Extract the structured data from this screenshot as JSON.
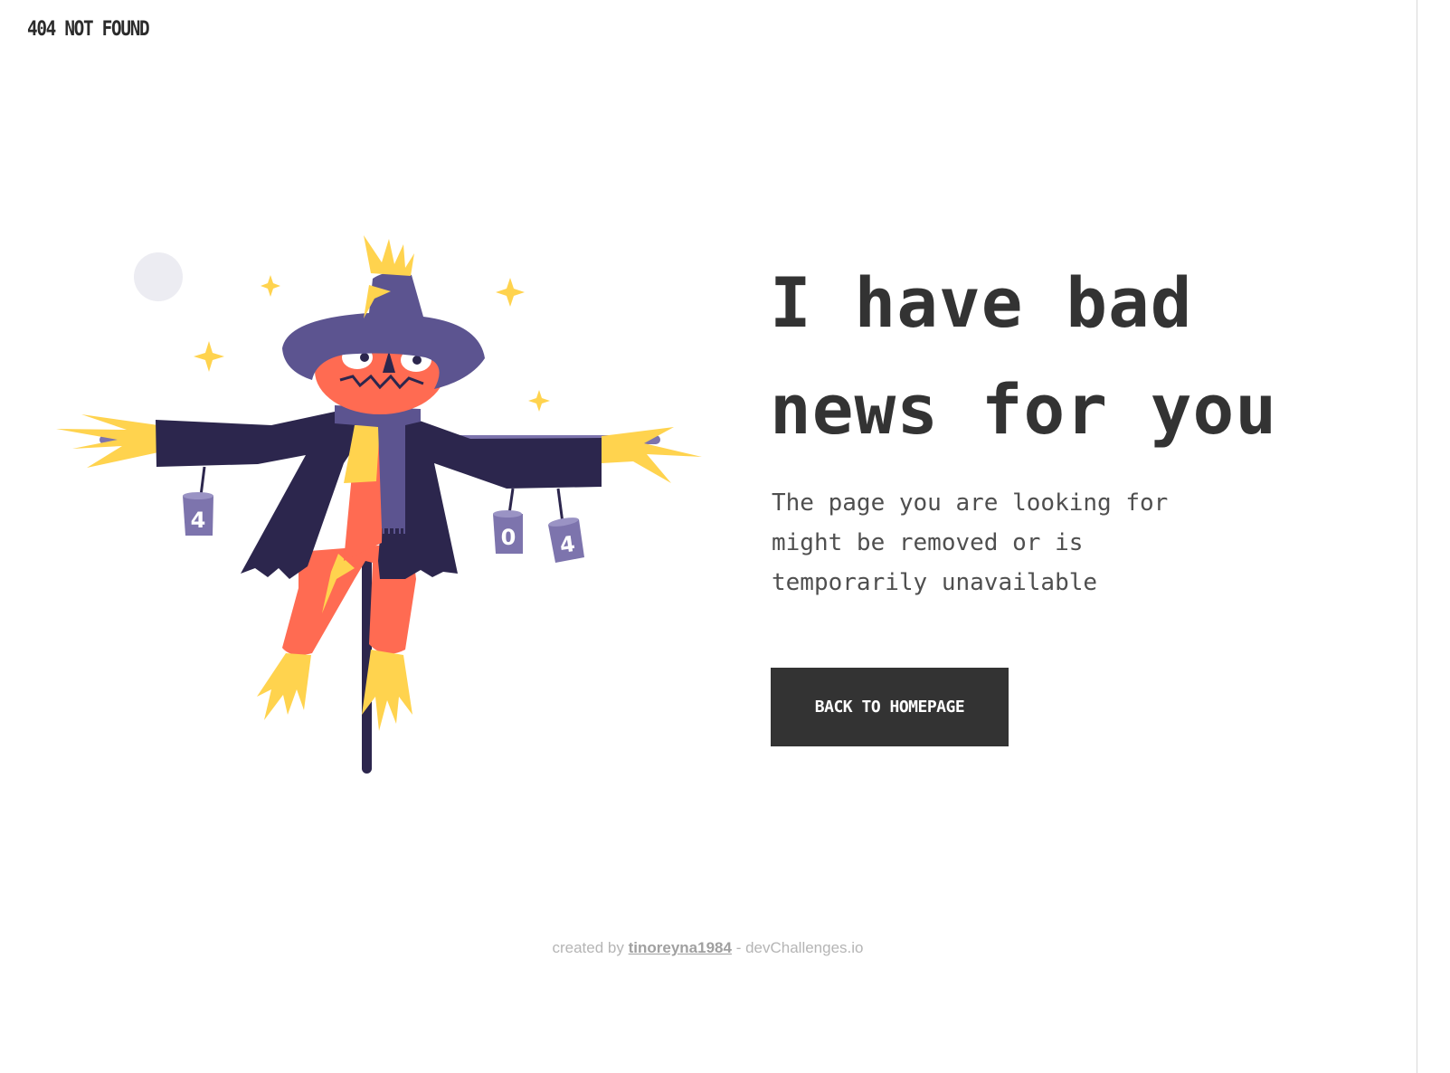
{
  "header": {
    "logo_text": "404 NOT FOUND"
  },
  "hero": {
    "headline_line1": "I have bad",
    "headline_line2": "news for you",
    "message": "The page you are looking for might be removed or is temporarily unavailable",
    "cta_label": "BACK TO HOMEPAGE"
  },
  "illustration": {
    "can_left_digit": "4",
    "can_middle_digit": "0",
    "can_right_digit": "4"
  },
  "footer": {
    "prefix": "created by",
    "author_link": "tinoreyna1984",
    "suffix": "- devChallenges.io"
  },
  "colors": {
    "text_dark": "#333333",
    "button_bg": "#333333",
    "coat": "#2c264d",
    "hat": "#5c5490",
    "pumpkin": "#ff6b52",
    "straw": "#ffd34e",
    "moon": "#ececf2"
  }
}
